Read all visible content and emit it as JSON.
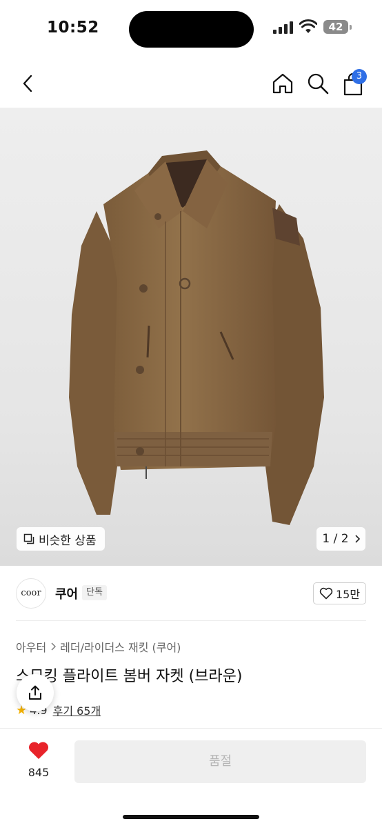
{
  "status": {
    "time": "10:52",
    "battery": "42"
  },
  "nav": {
    "cart_count": "3"
  },
  "hero": {
    "similar_label": "비슷한 상품",
    "pager": "1 / 2"
  },
  "brand": {
    "logo_text": "coor",
    "name": "쿠어",
    "tag": "단독",
    "likes": "15만"
  },
  "breadcrumb": {
    "category": "아우터",
    "subcategory": "레더/라이더스 재킷 (쿠어)"
  },
  "product": {
    "title": "스모킹 플라이트 봄버 자켓 (브라운)",
    "rating": "4.9",
    "reviews": "후기 65개"
  },
  "bottom": {
    "wish_count": "845",
    "buy_label": "품절"
  },
  "colors": {
    "accent": "#2f6fe6",
    "heart": "#e8232a",
    "star": "#f5b300",
    "jacket": "#8a6a44"
  }
}
